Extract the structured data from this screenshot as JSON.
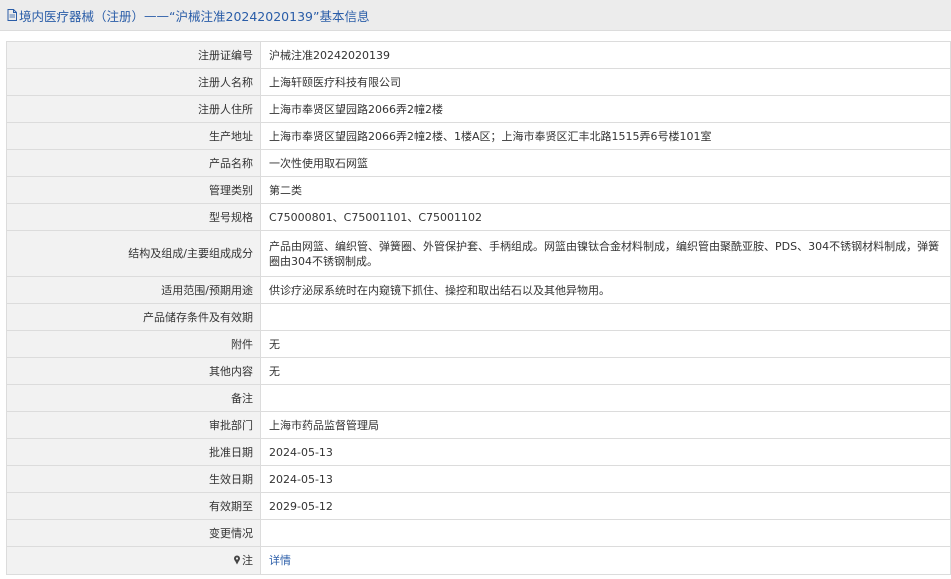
{
  "header": {
    "title_main": "境内医疗器械（注册）",
    "title_sep": "——",
    "title_id": "“沪械注准20242020139”基本信息"
  },
  "rows": [
    {
      "label": "注册证编号",
      "value": "沪械注准20242020139"
    },
    {
      "label": "注册人名称",
      "value": "上海轩颐医疗科技有限公司"
    },
    {
      "label": "注册人住所",
      "value": "上海市奉贤区望园路2066弄2幢2楼"
    },
    {
      "label": "生产地址",
      "value": "上海市奉贤区望园路2066弄2幢2楼、1楼A区；上海市奉贤区汇丰北路1515弄6号楼101室"
    },
    {
      "label": "产品名称",
      "value": "一次性使用取石网篮"
    },
    {
      "label": "管理类别",
      "value": "第二类"
    },
    {
      "label": "型号规格",
      "value": "C75000801、C75001101、C75001102"
    },
    {
      "label": "结构及组成/主要组成成分",
      "value": "产品由网篮、编织管、弹簧圈、外管保护套、手柄组成。网篮由镍钛合金材料制成，编织管由聚酰亚胺、PDS、304不锈钢材料制成，弹簧圈由304不锈钢制成。"
    },
    {
      "label": "适用范围/预期用途",
      "value": "供诊疗泌尿系统时在内窥镜下抓住、操控和取出结石以及其他异物用。"
    },
    {
      "label": "产品储存条件及有效期",
      "value": ""
    },
    {
      "label": "附件",
      "value": "无"
    },
    {
      "label": "其他内容",
      "value": "无"
    },
    {
      "label": "备注",
      "value": ""
    },
    {
      "label": "审批部门",
      "value": "上海市药品监督管理局"
    },
    {
      "label": "批准日期",
      "value": "2024-05-13"
    },
    {
      "label": "生效日期",
      "value": "2024-05-13"
    },
    {
      "label": "有效期至",
      "value": "2029-05-12"
    },
    {
      "label": "变更情况",
      "value": ""
    },
    {
      "label": "注",
      "value": "详情"
    }
  ],
  "icons": {
    "header_icon": "document-icon",
    "note_icon": "pin-icon"
  },
  "colors": {
    "link": "#2a5da8",
    "header_bg": "#ececec",
    "label_bg": "#f2f2f2",
    "border": "#dcdcdc"
  }
}
